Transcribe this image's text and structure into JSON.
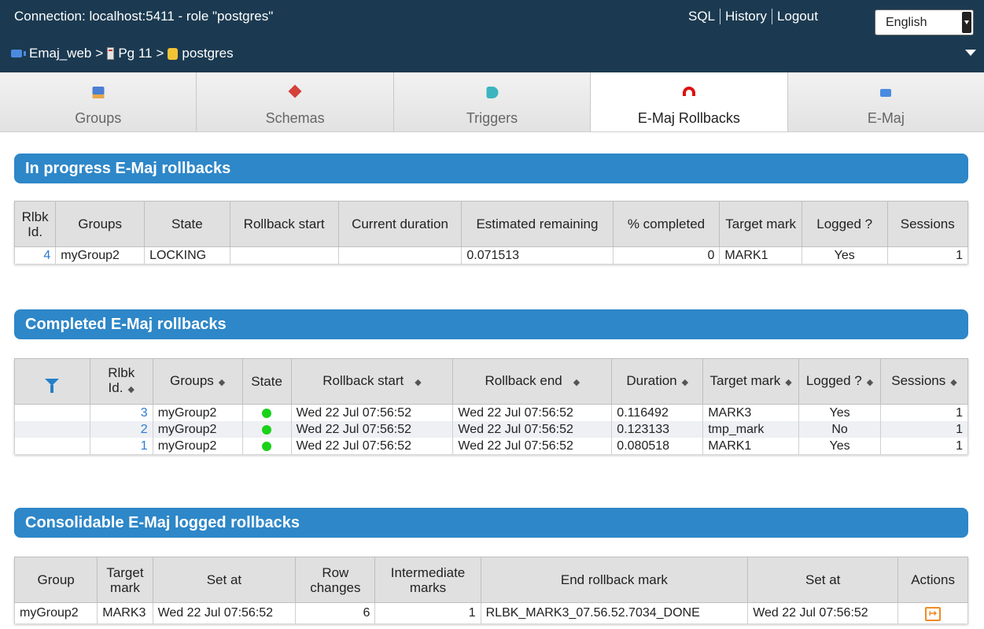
{
  "header": {
    "connection": "Connection: localhost:5411 - role \"postgres\"",
    "links": {
      "sql": "SQL",
      "history": "History",
      "logout": "Logout"
    },
    "language": "English",
    "breadcrumb": {
      "app": "Emaj_web",
      "server": "Pg 11",
      "database": "postgres",
      "sep": ">"
    }
  },
  "tabs": [
    {
      "label": "Groups",
      "icon": "groups-icon"
    },
    {
      "label": "Schemas",
      "icon": "schemas-icon"
    },
    {
      "label": "Triggers",
      "icon": "triggers-icon"
    },
    {
      "label": "E-Maj Rollbacks",
      "icon": "rollback-icon",
      "active": true
    },
    {
      "label": "E-Maj",
      "icon": "emaj-icon"
    }
  ],
  "inprogress": {
    "title": "In progress E-Maj rollbacks",
    "headers": [
      "Rlbk Id.",
      "Groups",
      "State",
      "Rollback start",
      "Current duration",
      "Estimated remaining",
      "% completed",
      "Target mark",
      "Logged ?",
      "Sessions"
    ],
    "rows": [
      {
        "id": "4",
        "group": "myGroup2",
        "state": "LOCKING",
        "start": "",
        "duration": "",
        "remaining": "0.071513",
        "pct": "0",
        "mark": "MARK1",
        "logged": "Yes",
        "sessions": "1"
      }
    ]
  },
  "completed": {
    "title": "Completed E-Maj rollbacks",
    "headers": [
      "Rlbk Id.",
      "Groups",
      "State",
      "Rollback start",
      "Rollback end",
      "Duration",
      "Target mark",
      "Logged ?",
      "Sessions"
    ],
    "state_color": "#19d219",
    "rows": [
      {
        "id": "3",
        "group": "myGroup2",
        "start": "Wed 22 Jul 07:56:52",
        "end": "Wed 22 Jul 07:56:52",
        "duration": "0.116492",
        "mark": "MARK3",
        "logged": "Yes",
        "sessions": "1"
      },
      {
        "id": "2",
        "group": "myGroup2",
        "start": "Wed 22 Jul 07:56:52",
        "end": "Wed 22 Jul 07:56:52",
        "duration": "0.123133",
        "mark": "tmp_mark",
        "logged": "No",
        "sessions": "1"
      },
      {
        "id": "1",
        "group": "myGroup2",
        "start": "Wed 22 Jul 07:56:52",
        "end": "Wed 22 Jul 07:56:52",
        "duration": "0.080518",
        "mark": "MARK1",
        "logged": "Yes",
        "sessions": "1"
      }
    ]
  },
  "consolidable": {
    "title": "Consolidable E-Maj logged rollbacks",
    "headers": [
      "Group",
      "Target mark",
      "Set at",
      "Row changes",
      "Intermediate marks",
      "End rollback mark",
      "Set at",
      "Actions"
    ],
    "rows": [
      {
        "group": "myGroup2",
        "mark": "MARK3",
        "set_at": "Wed 22 Jul 07:56:52",
        "row_changes": "6",
        "inter_marks": "1",
        "end_mark": "RLBK_MARK3_07.56.52.7034_DONE",
        "end_set_at": "Wed 22 Jul 07:56:52",
        "action_icon": "consolidate-icon"
      }
    ]
  }
}
